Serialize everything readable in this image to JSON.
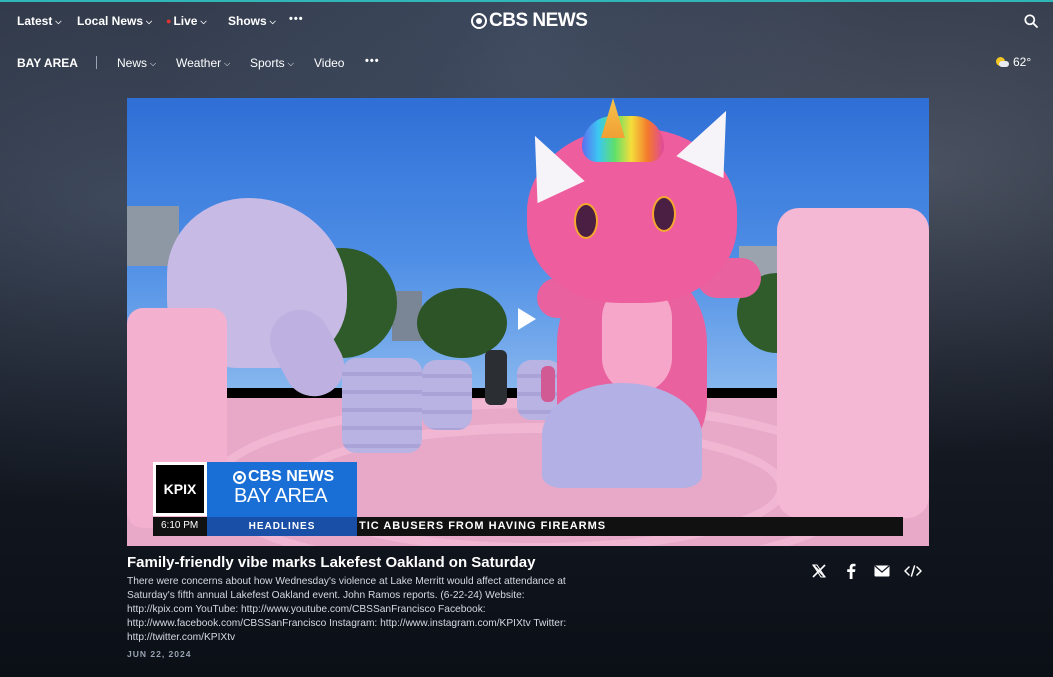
{
  "top_nav": {
    "items": [
      {
        "label": "Latest"
      },
      {
        "label": "Local News"
      },
      {
        "label": "Live"
      },
      {
        "label": "Shows"
      }
    ],
    "more": "•••",
    "logo_text": "CBS NEWS"
  },
  "sub_nav": {
    "title": "BAY AREA",
    "items": [
      {
        "label": "News"
      },
      {
        "label": "Weather"
      },
      {
        "label": "Sports"
      },
      {
        "label": "Video"
      }
    ],
    "more": "•••",
    "weather_temp": "62°"
  },
  "video": {
    "lower_third": {
      "station": "KPIX",
      "brand_line1": "CBS NEWS",
      "brand_line2": "BAY AREA",
      "time": "6:10 PM",
      "segment": "HEADLINES",
      "ticker": "TIC ABUSERS FROM HAVING FIREARMS"
    }
  },
  "article": {
    "headline": "Family-friendly vibe marks Lakefest Oakland on Saturday",
    "description": "There were concerns about how Wednesday's violence at Lake Merritt would affect attendance at Saturday's fifth annual Lakefest Oakland event. John Ramos reports. (6-22-24) Website: http://kpix.com YouTube: http://www.youtube.com/CBSSanFrancisco Facebook: http://www.facebook.com/CBSSanFrancisco Instagram: http://www.instagram.com/KPIXtv Twitter: http://twitter.com/KPIXtv",
    "date": "JUN 22, 2024"
  },
  "share_icons": [
    "x-icon",
    "facebook-icon",
    "email-icon",
    "embed-icon"
  ],
  "colors": {
    "accent_live": "#e3342f",
    "brand_blue": "#1a6fd6",
    "teal_strip": "#2fb7b7"
  }
}
